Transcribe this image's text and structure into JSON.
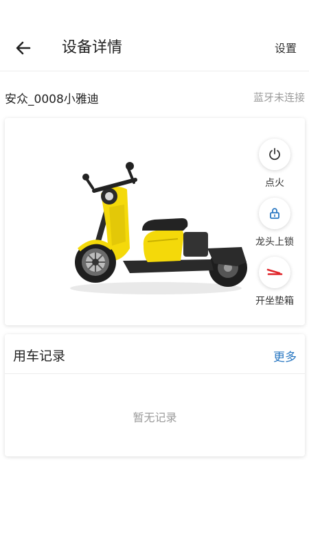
{
  "header": {
    "title": "设备详情",
    "settings_label": "设置",
    "back_icon": "arrow-left-icon"
  },
  "device": {
    "name": "安众_0008小雅迪",
    "bluetooth_status": "蓝牙未连接"
  },
  "vehicle": {
    "image": "yellow-scooter",
    "controls": [
      {
        "label": "点火",
        "icon": "power-icon",
        "color": "#333333"
      },
      {
        "label": "龙头上锁",
        "icon": "lock-icon",
        "color": "#2a78c2"
      },
      {
        "label": "开坐垫箱",
        "icon": "seat-box-icon",
        "color": "#e0262b"
      }
    ]
  },
  "records": {
    "title": "用车记录",
    "more_label": "更多",
    "empty_text": "暂无记录"
  },
  "colors": {
    "accent": "#2a78c2",
    "muted": "#9a9a9a",
    "scooter_yellow": "#f4d90a",
    "alert_red": "#e0262b"
  }
}
